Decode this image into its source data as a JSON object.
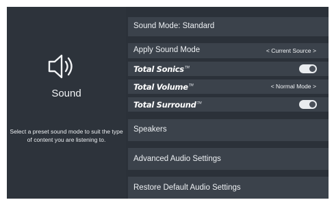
{
  "left_panel": {
    "title": "Sound",
    "description": "Select a preset sound mode to suit the type of content you are listening to.",
    "icon": "speaker-icon"
  },
  "menu": {
    "sound_mode": "Sound Mode: Standard",
    "apply_sound_mode": {
      "label": "Apply Sound Mode",
      "value": "< Current Source >"
    },
    "total_sonics": {
      "brand": "Total Sonics",
      "enabled": false
    },
    "total_volume": {
      "brand": "Total Volume",
      "value": "< Normal Mode >"
    },
    "total_surround": {
      "brand": "Total Surround",
      "enabled": false
    },
    "speakers": "Speakers",
    "advanced_audio": "Advanced Audio Settings",
    "restore_defaults": "Restore Default Audio Settings"
  },
  "colors": {
    "screen_bg": "#2b3139",
    "item_bg": "#3b424b",
    "text": "#eef1f4",
    "toggle_track": "#e9ecef"
  }
}
